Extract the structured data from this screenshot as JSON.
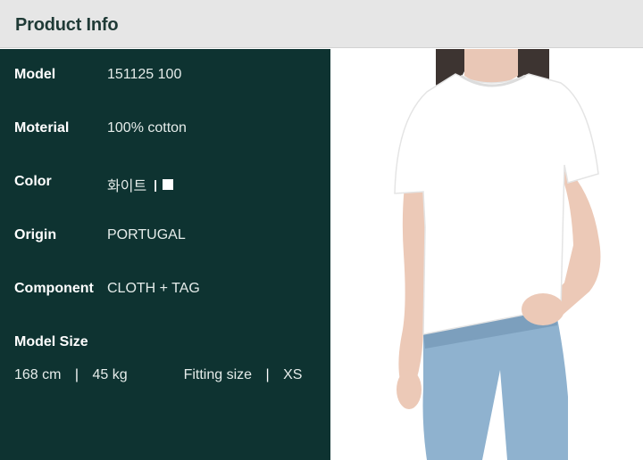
{
  "header": {
    "title": "Product Info"
  },
  "specs": [
    {
      "label": "Model",
      "value": "151125 100"
    },
    {
      "label": "Moterial",
      "value": "100% cotton"
    },
    {
      "label": "Color",
      "value": "화이트"
    },
    {
      "label": "Origin",
      "value": "PORTUGAL"
    },
    {
      "label": "Component",
      "value": "CLOTH + TAG"
    }
  ],
  "color_separator": "|",
  "color_swatch": "#ffffff",
  "model_size": {
    "label": "Model Size",
    "height": "168 cm",
    "separator": "|",
    "weight": "45 kg",
    "fitting_label": "Fitting size",
    "fitting_value": "XS"
  },
  "colors": {
    "header_bg": "#e6e6e6",
    "panel_bg": "#0e3331",
    "shirt": "#ffffff",
    "jeans": "#8fb2cf"
  },
  "image": {
    "subject": "model-wearing-white-tshirt-and-blue-jeans"
  }
}
